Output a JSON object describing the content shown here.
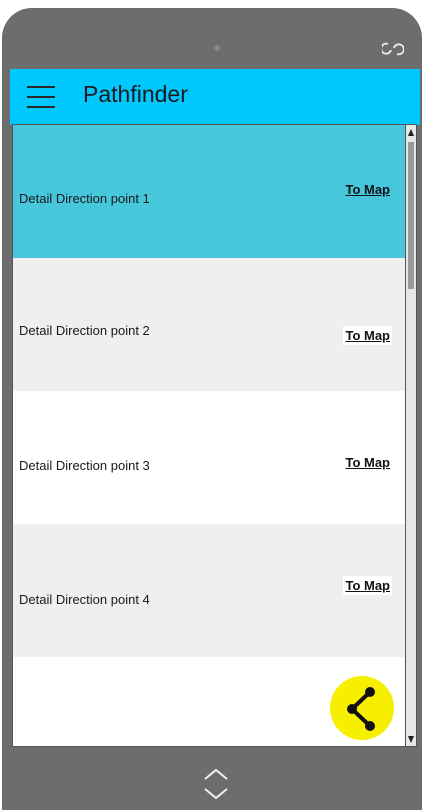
{
  "app": {
    "title": "Pathfinder"
  },
  "rows": [
    {
      "text": "Detail Direction point 1",
      "link": "To Map"
    },
    {
      "text": "Detail Direction point 2",
      "link": "To Map"
    },
    {
      "text": "Detail Direction point 3",
      "link": "To Map"
    },
    {
      "text": "Detail Direction point 4",
      "link": "To Map"
    }
  ],
  "colors": {
    "appbar": "#00c8ff",
    "selected_row": "#46c7db",
    "alt_row": "#efefef",
    "fab": "#f7ef00",
    "phone_frame": "#6d6d6d"
  },
  "icons": [
    "rotate-icon",
    "hamburger-menu-icon",
    "share-icon",
    "chevron-up-icon",
    "chevron-down-icon"
  ]
}
